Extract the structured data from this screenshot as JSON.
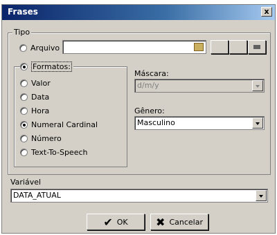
{
  "window": {
    "title": "Frases",
    "close_glyph": "x"
  },
  "tipo": {
    "legend": "Tipo",
    "arquivo_label": "Arquivo",
    "arquivo_value": ""
  },
  "formatos": {
    "legend": "Formatos:",
    "options": [
      {
        "label": "Valor",
        "checked": false
      },
      {
        "label": "Data",
        "checked": false
      },
      {
        "label": "Hora",
        "checked": false
      },
      {
        "label": "Numeral Cardinal",
        "checked": true
      },
      {
        "label": "Número",
        "checked": false
      },
      {
        "label": "Text-To-Speech",
        "checked": false
      }
    ]
  },
  "mascara": {
    "label": "Máscara:",
    "value": "d/m/y"
  },
  "genero": {
    "label": "Gênero:",
    "value": "Masculino"
  },
  "variavel": {
    "label": "Variável",
    "value": "DATA_ATUAL"
  },
  "buttons": {
    "ok_label": "OK",
    "cancel_label": "Cancelar"
  },
  "icons": {
    "ok": "check-icon",
    "cancel": "x-icon",
    "browse": "folder-icon"
  }
}
